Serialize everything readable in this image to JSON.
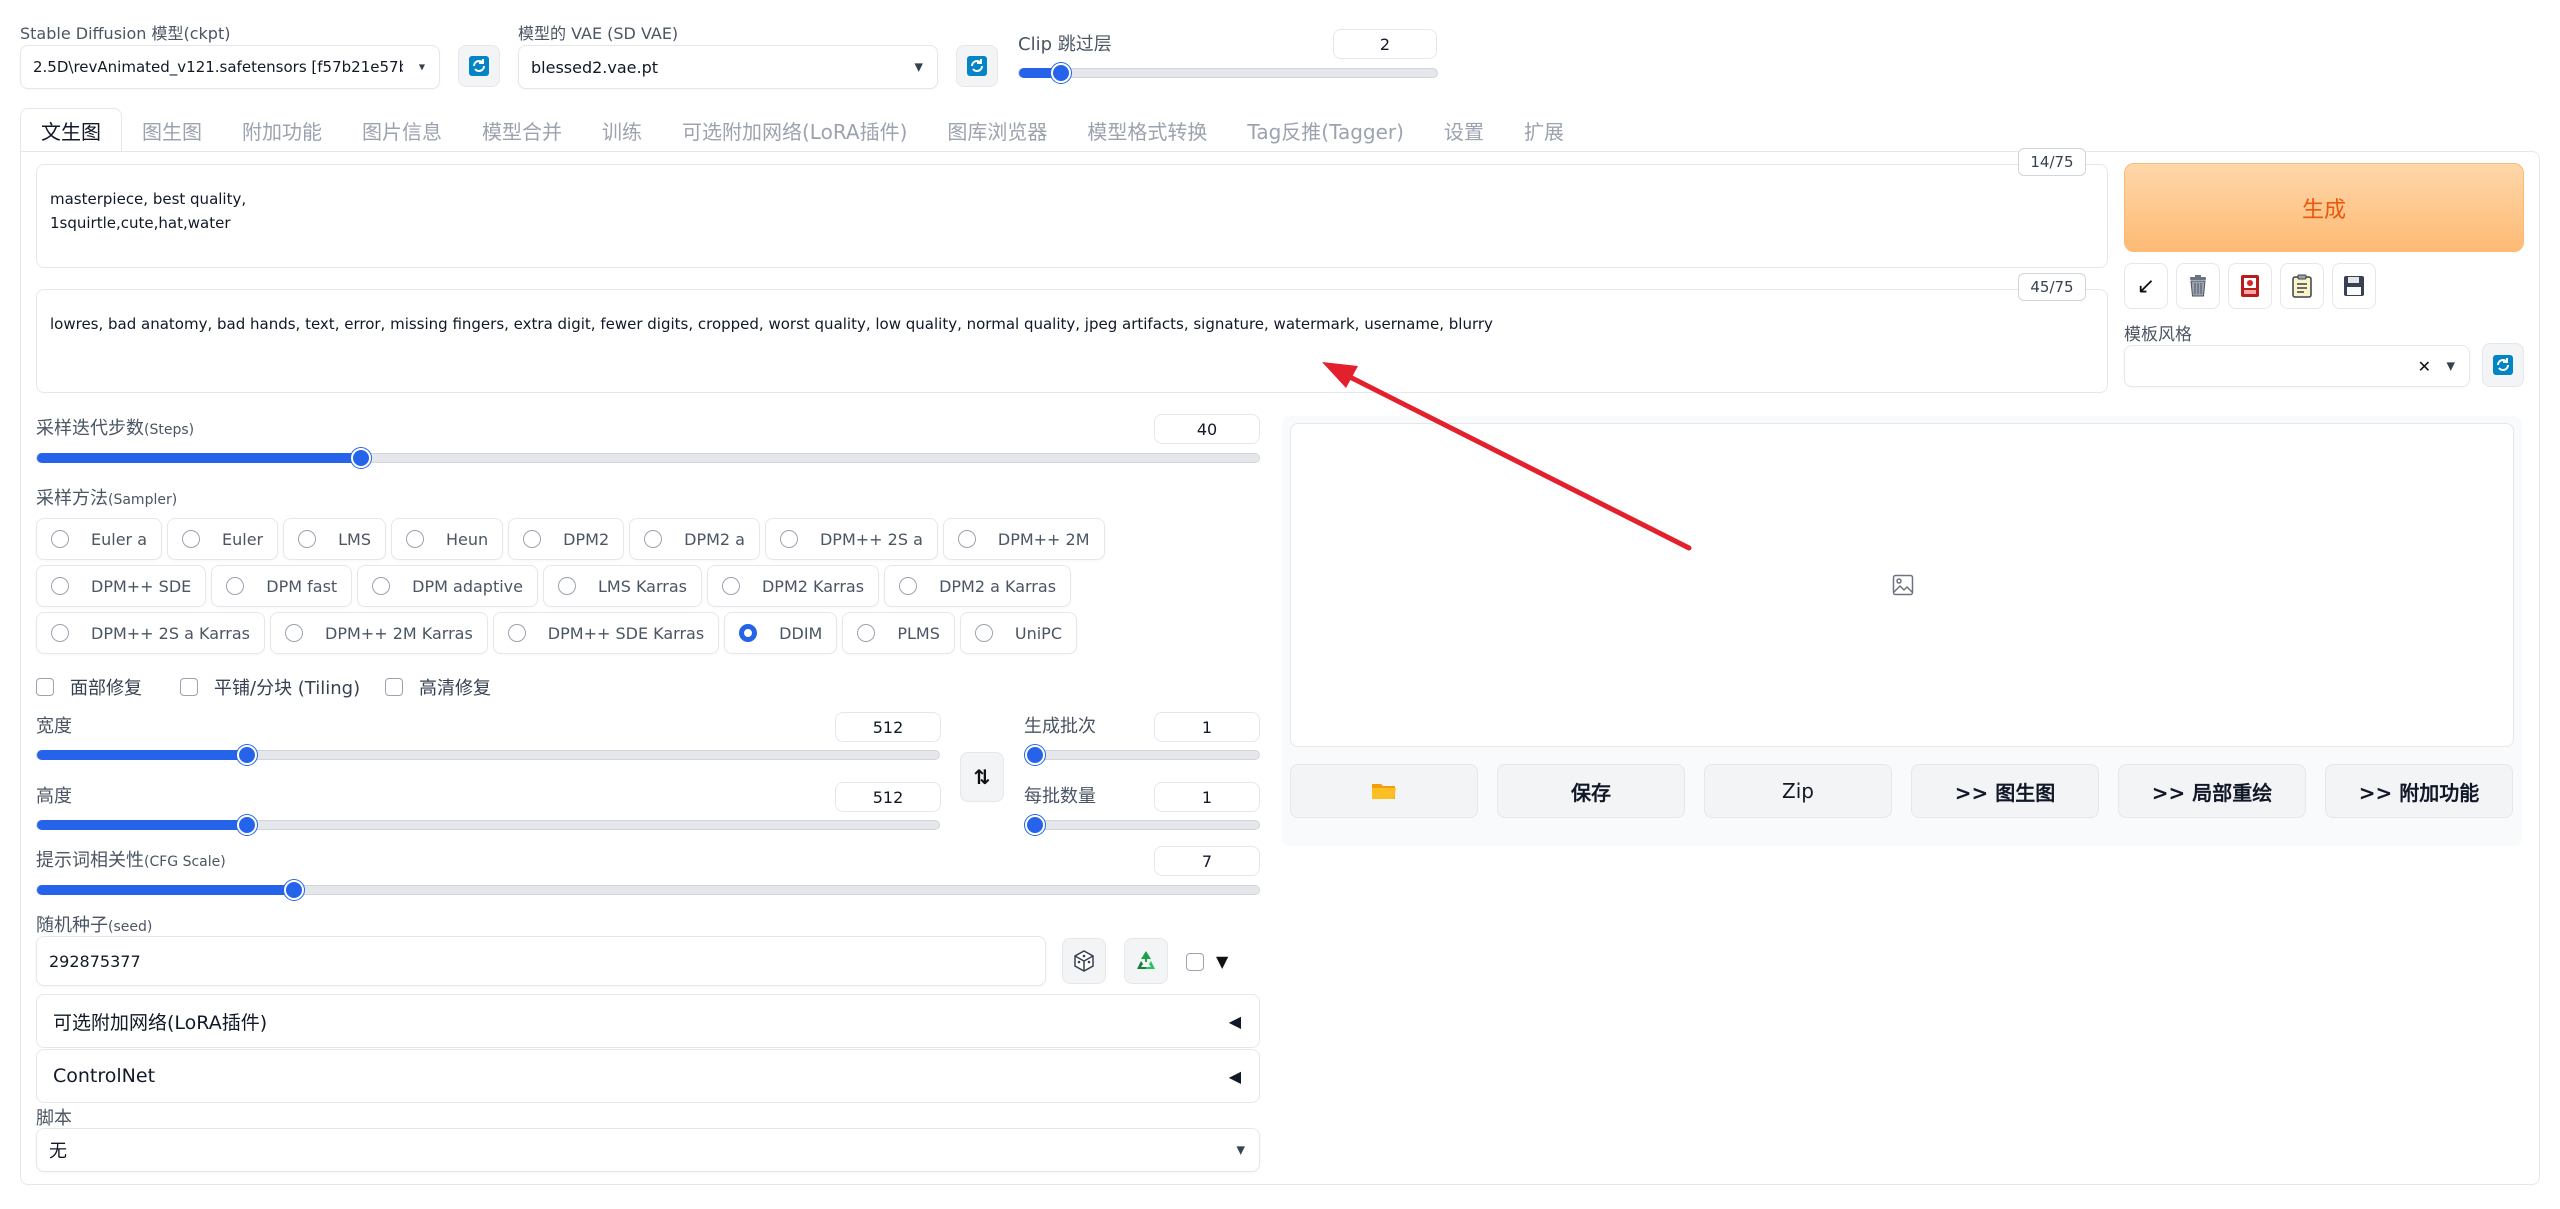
{
  "top": {
    "model_label": "Stable Diffusion 模型(ckpt)",
    "model_value": "2.5D\\revAnimated_v121.safetensors [f57b21e57b",
    "vae_label": "模型的 VAE (SD VAE)",
    "vae_value": "blessed2.vae.pt",
    "clip_label": "Clip 跳过层",
    "clip_value": "2",
    "clip_level": 0.1
  },
  "tabs": [
    "文生图",
    "图生图",
    "附加功能",
    "图片信息",
    "模型合并",
    "训练",
    "可选附加网络(LoRA插件)",
    "图库浏览器",
    "模型格式转换",
    "Tag反推(Tagger)",
    "设置",
    "扩展"
  ],
  "prompt": {
    "positive_line1": "masterpiece, best quality,",
    "positive_line2": "1squirtle,cute,hat,water",
    "positive_counter": "14/75",
    "negative": "lowres, bad anatomy, bad hands, text, error, missing fingers, extra digit, fewer digits, cropped, worst quality, low quality, normal quality, jpeg artifacts, signature, watermark, username, blurry",
    "negative_counter": "45/75"
  },
  "generate_label": "生成",
  "style_label": "模板风格",
  "steps": {
    "label": "采样迭代步数",
    "label_en": "(Steps)",
    "value": "40",
    "level": 0.265
  },
  "sampler": {
    "label": "采样方法",
    "label_en": "(Sampler)",
    "options": [
      "Euler a",
      "Euler",
      "LMS",
      "Heun",
      "DPM2",
      "DPM2 a",
      "DPM++ 2S a",
      "DPM++ 2M",
      "DPM++ SDE",
      "DPM fast",
      "DPM adaptive",
      "LMS Karras",
      "DPM2 Karras",
      "DPM2 a Karras",
      "DPM++ 2S a Karras",
      "DPM++ 2M Karras",
      "DPM++ SDE Karras",
      "DDIM",
      "PLMS",
      "UniPC"
    ],
    "selected": "DDIM"
  },
  "checks": {
    "face": "面部修复",
    "tiling": "平铺/分块 (Tiling)",
    "hires": "高清修复"
  },
  "width": {
    "label": "宽度",
    "value": "512",
    "level": 0.233
  },
  "height": {
    "label": "高度",
    "value": "512",
    "level": 0.233
  },
  "batch_count": {
    "label": "生成批次",
    "value": "1",
    "level": 0.0
  },
  "batch_size": {
    "label": "每批数量",
    "value": "1",
    "level": 0.0
  },
  "cfg": {
    "label": "提示词相关性",
    "label_en": "(CFG Scale)",
    "value": "7",
    "level": 0.21
  },
  "seed": {
    "label": "随机种子",
    "label_en": "(seed)",
    "value": "292875377"
  },
  "accordions": {
    "lora": "可选附加网络(LoRA插件)",
    "controlnet": "ControlNet"
  },
  "script": {
    "label": "脚本",
    "value": "无"
  },
  "output_buttons": {
    "save": "保存",
    "zip": "Zip",
    "img2img": ">> 图生图",
    "inpaint": ">> 局部重绘",
    "extras": ">> 附加功能"
  },
  "colors": {
    "accent": "#2563eb",
    "generate": "#fdba74",
    "generate_text": "#ea580c",
    "annotation_arrow": "#e3202b"
  }
}
